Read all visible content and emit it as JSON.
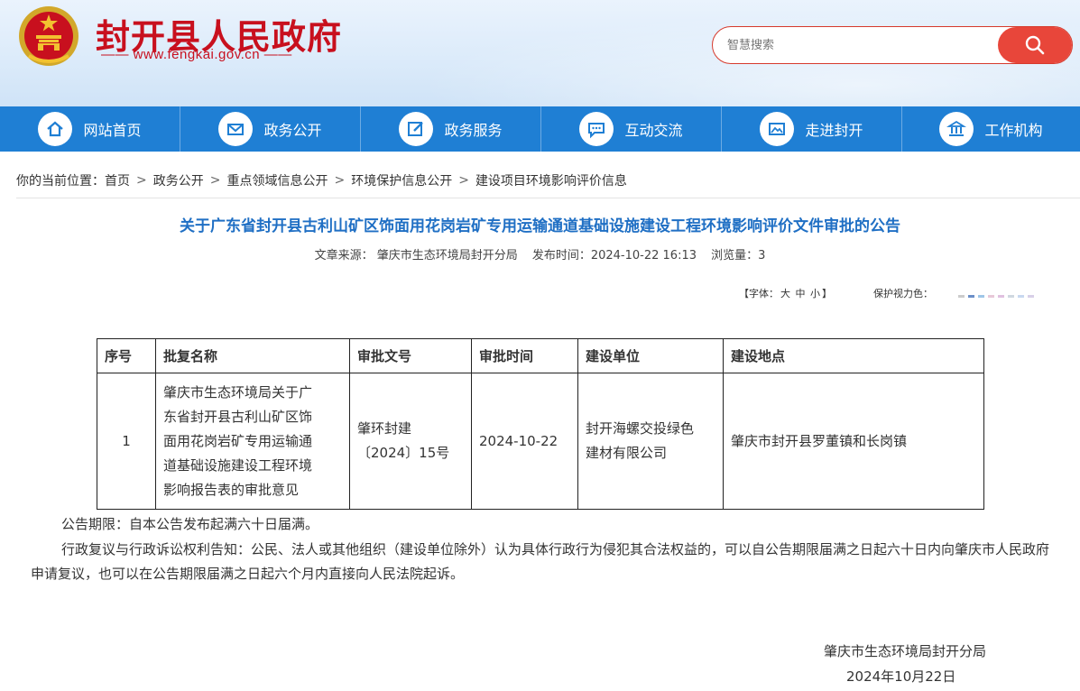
{
  "header": {
    "title": "封开县人民政府",
    "url": "—— www.fengkai.gov.cn ——",
    "search_placeholder": "智慧搜索",
    "colors": {
      "title_red": "#c8101e",
      "search_orange": "#e8463a",
      "nav_blue": "#1f7fd4"
    }
  },
  "nav": [
    {
      "label": "网站首页",
      "icon": "home-icon"
    },
    {
      "label": "政务公开",
      "icon": "mail-icon"
    },
    {
      "label": "政务服务",
      "icon": "edit-icon"
    },
    {
      "label": "互动交流",
      "icon": "chat-icon"
    },
    {
      "label": "走进封开",
      "icon": "picture-icon"
    },
    {
      "label": "工作机构",
      "icon": "building-icon"
    }
  ],
  "breadcrumb": {
    "prefix": "你的当前位置：",
    "items": [
      "首页",
      "政务公开",
      "重点领域信息公开",
      "环境保护信息公开",
      "建设项目环境影响评价信息"
    ],
    "separator": ">"
  },
  "article": {
    "title": "关于广东省封开县古利山矿区饰面用花岗岩矿专用运输通道基础设施建设工程环境影响评价文件审批的公告",
    "source": "文章来源：  肇庆市生态环境局封开分局",
    "publish_time": "发布时间：2024-10-22 16:13",
    "views": "浏览量：3"
  },
  "tools": {
    "font_open": "【字体：",
    "font_large": "大",
    "font_medium": "中",
    "font_small": "小",
    "font_close": "】",
    "eye_label": "保护视力色：",
    "eye_colors": [
      "#cccccc",
      "#6c8fc8",
      "#9fc6e8",
      "#e8c8d8",
      "#e0c0e0",
      "#d0d8e0",
      "#c8d8f0",
      "#d8d0e8"
    ]
  },
  "table": {
    "headers": [
      "序号",
      "批复名称",
      "审批文号",
      "审批时间",
      "建设单位",
      "建设地点"
    ],
    "row": {
      "no": "1",
      "name_lines": [
        "肇庆市生态环境局关于广",
        "东省封开县古利山矿区饰",
        "面用花岗岩矿专用运输通",
        "道基础设施建设工程环境",
        "影响报告表的审批意见"
      ],
      "doc_lines": [
        "肇环封建",
        "〔2024〕15号"
      ],
      "date": "2024-10-22",
      "unit_lines": [
        "封开海螺交投绿色",
        "建材有限公司"
      ],
      "location": "肇庆市封开县罗董镇和长岗镇"
    }
  },
  "notice": {
    "period": "公告期限：自本公告发布起满六十日届满。",
    "review": "行政复议与行政诉讼权利告知：公民、法人或其他组织（建设单位除外）认为具体行政行为侵犯其合法权益的，可以自公告期限届满之日起六十日内向肇庆市人民政府申请复议，也可以在公告期限届满之日起六个月内直接向人民法院起诉。"
  },
  "signature": {
    "org": "肇庆市生态环境局封开分局",
    "date": "2024年10月22日"
  }
}
